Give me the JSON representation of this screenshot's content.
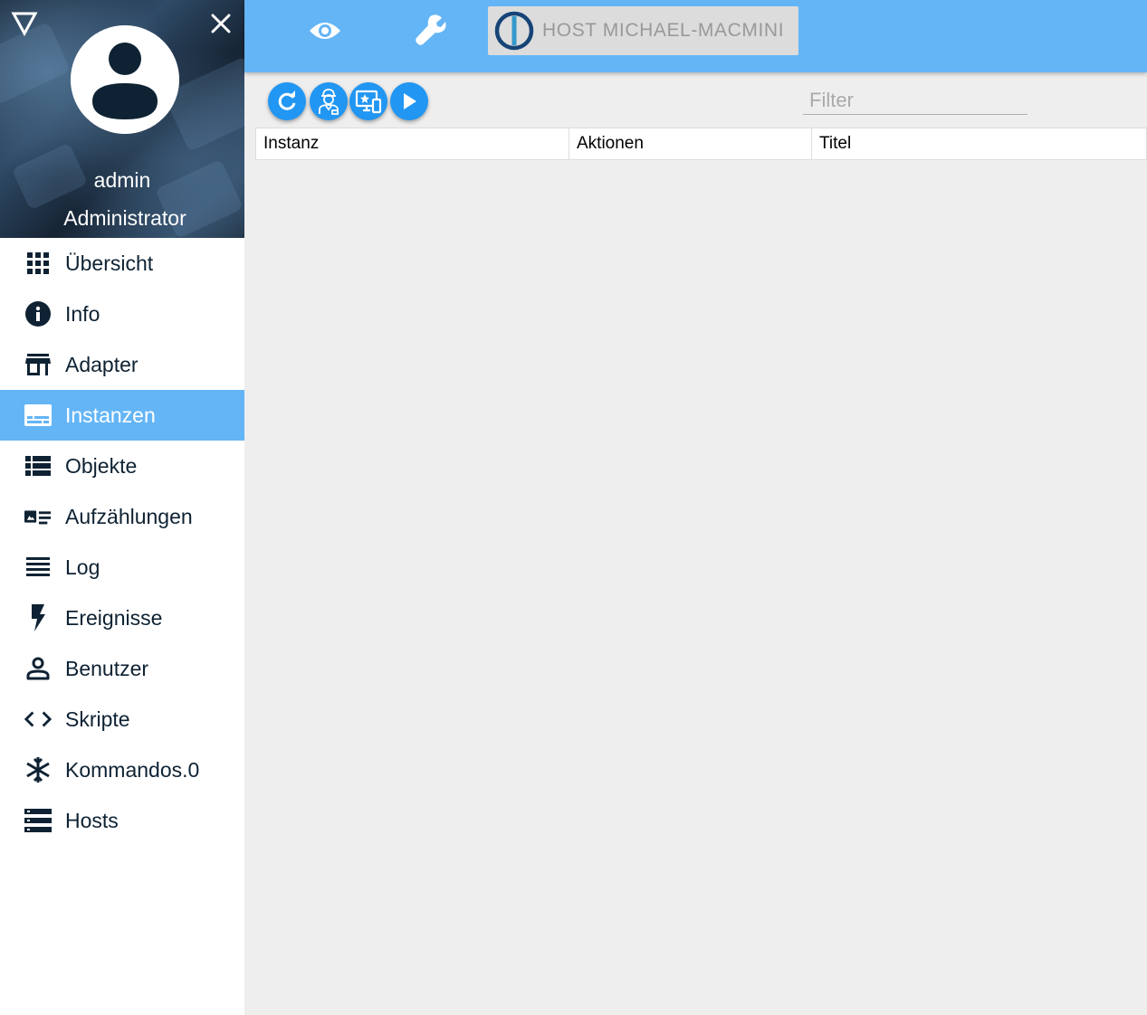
{
  "sidebar": {
    "user_name": "admin",
    "user_role": "Administrator",
    "items": [
      {
        "label": "Übersicht",
        "icon": "apps-grid-icon"
      },
      {
        "label": "Info",
        "icon": "info-icon"
      },
      {
        "label": "Adapter",
        "icon": "store-icon"
      },
      {
        "label": "Instanzen",
        "icon": "subtitles-icon",
        "active": true
      },
      {
        "label": "Objekte",
        "icon": "view-list-icon"
      },
      {
        "label": "Aufzählungen",
        "icon": "featured-list-icon"
      },
      {
        "label": "Log",
        "icon": "lines-icon"
      },
      {
        "label": "Ereignisse",
        "icon": "flash-icon"
      },
      {
        "label": "Benutzer",
        "icon": "person-icon"
      },
      {
        "label": "Skripte",
        "icon": "code-icon"
      },
      {
        "label": "Kommandos.0",
        "icon": "snowflake-icon"
      },
      {
        "label": "Hosts",
        "icon": "storage-icon"
      }
    ]
  },
  "topbar": {
    "host_label": "HOST MICHAEL-MACMINI",
    "icons": [
      "eye-icon",
      "wrench-icon",
      "iobroker-logo-icon"
    ]
  },
  "toolbar": {
    "buttons": [
      "refresh-icon",
      "expert-mode-icon",
      "instance-screens-icon",
      "play-icon"
    ],
    "filter_placeholder": "Filter"
  },
  "table": {
    "columns": [
      "Instanz",
      "Aktionen",
      "Titel"
    ]
  },
  "colors": {
    "accent": "#64b5f6",
    "fab": "#2196f3",
    "nav_text": "#0e2233",
    "background": "#eeeeee"
  }
}
